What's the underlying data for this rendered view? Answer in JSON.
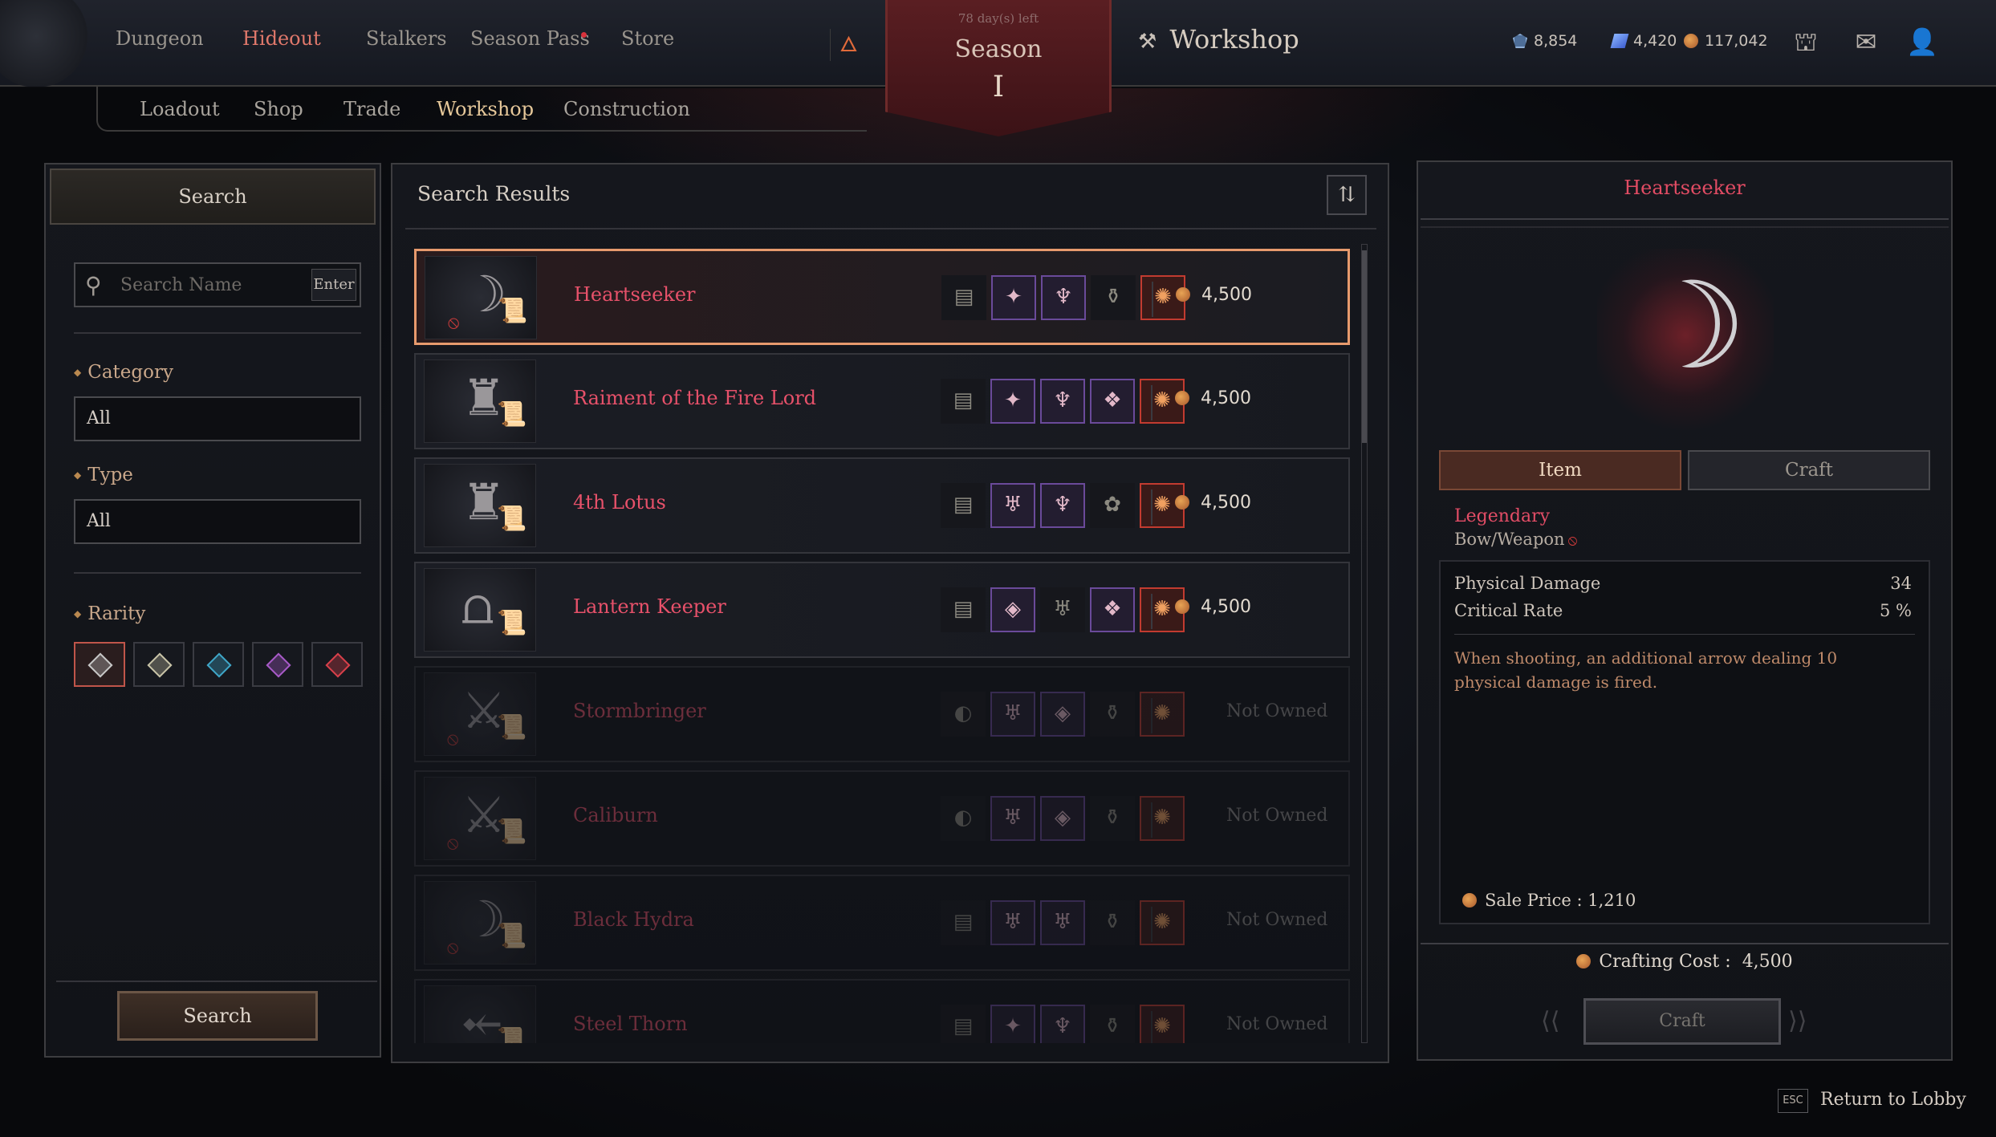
{
  "colors": {
    "accent_legendary": "#e24c64",
    "active_nav": "#e0786b",
    "active_subnav": "#e6c89a",
    "selected_border": "#e79a6d",
    "epic": "#6a4a9a",
    "legendary_frame": "#c23b30"
  },
  "top_nav": {
    "items": [
      {
        "label": "Dungeon",
        "active": false
      },
      {
        "label": "Hideout",
        "active": true
      },
      {
        "label": "Stalkers",
        "active": false
      },
      {
        "label": "Season Pass",
        "active": false,
        "notification": true
      },
      {
        "label": "Store",
        "active": false
      }
    ],
    "flame_icon": "flame-icon"
  },
  "season_banner": {
    "days_left": "78 day(s) left",
    "label": "Season",
    "numeral": "I"
  },
  "page_title": "Workshop",
  "currencies": [
    {
      "icon": "gem-shield-icon",
      "value": "8,854"
    },
    {
      "icon": "blue-crystal-icon",
      "value": "4,420"
    },
    {
      "icon": "gold-coin-icon",
      "value": "117,042"
    }
  ],
  "top_icons": [
    "treasure-chest-icon",
    "mail-icon",
    "friends-icon"
  ],
  "sub_nav": {
    "items": [
      {
        "label": "Loadout",
        "active": false
      },
      {
        "label": "Shop",
        "active": false
      },
      {
        "label": "Trade",
        "active": false
      },
      {
        "label": "Workshop",
        "active": true
      },
      {
        "label": "Construction",
        "active": false
      }
    ]
  },
  "filters": {
    "header": "Search",
    "search_placeholder": "Search Name",
    "search_value": "",
    "enter_label": "Enter",
    "category_label": "Category",
    "category_value": "All",
    "type_label": "Type",
    "type_value": "All",
    "rarity_label": "Rarity",
    "rarity_options": [
      {
        "name": "all",
        "color": "#c8c8c8",
        "selected": true
      },
      {
        "name": "uncommon",
        "color": "#c9c4a8",
        "selected": false
      },
      {
        "name": "rare",
        "color": "#3fa6c8",
        "selected": false
      },
      {
        "name": "epic",
        "color": "#a85ac8",
        "selected": false
      },
      {
        "name": "legendary",
        "color": "#d8404a",
        "selected": false
      }
    ],
    "search_button": "Search"
  },
  "results": {
    "title": "Search Results",
    "sort_icon": "sort-icon",
    "items": [
      {
        "name": "Heartseeker",
        "art": "bow",
        "banned": true,
        "price": "4,500",
        "owned": true,
        "selected": true,
        "materials": [
          {
            "glyph": "▤",
            "tone": "plain"
          },
          {
            "glyph": "✦",
            "tone": "purple"
          },
          {
            "glyph": "♆",
            "tone": "purple"
          },
          {
            "glyph": "⚱",
            "tone": "plain"
          },
          {
            "glyph": "✺",
            "tone": "red"
          }
        ]
      },
      {
        "name": "Raiment of the Fire Lord",
        "art": "robe",
        "banned": false,
        "price": "4,500",
        "owned": true,
        "selected": false,
        "materials": [
          {
            "glyph": "▤",
            "tone": "plain"
          },
          {
            "glyph": "✦",
            "tone": "purple"
          },
          {
            "glyph": "♆",
            "tone": "purple"
          },
          {
            "glyph": "❖",
            "tone": "purple"
          },
          {
            "glyph": "✺",
            "tone": "red"
          }
        ]
      },
      {
        "name": "4th Lotus",
        "art": "tunic",
        "banned": false,
        "price": "4,500",
        "owned": true,
        "selected": false,
        "materials": [
          {
            "glyph": "▤",
            "tone": "plain"
          },
          {
            "glyph": "♅",
            "tone": "purple"
          },
          {
            "glyph": "♆",
            "tone": "purple"
          },
          {
            "glyph": "✿",
            "tone": "plain"
          },
          {
            "glyph": "✺",
            "tone": "red"
          }
        ]
      },
      {
        "name": "Lantern Keeper",
        "art": "pants",
        "banned": false,
        "price": "4,500",
        "owned": true,
        "selected": false,
        "materials": [
          {
            "glyph": "▤",
            "tone": "plain"
          },
          {
            "glyph": "◈",
            "tone": "purple"
          },
          {
            "glyph": "♅",
            "tone": "plain"
          },
          {
            "glyph": "❖",
            "tone": "purple"
          },
          {
            "glyph": "✺",
            "tone": "red"
          }
        ]
      },
      {
        "name": "Stormbringer",
        "art": "sword",
        "banned": true,
        "owned": false,
        "status": "Not Owned",
        "selected": false,
        "materials": [
          {
            "glyph": "◐",
            "tone": "plain"
          },
          {
            "glyph": "♅",
            "tone": "purple"
          },
          {
            "glyph": "◈",
            "tone": "purple"
          },
          {
            "glyph": "⚱",
            "tone": "plain"
          },
          {
            "glyph": "✺",
            "tone": "red"
          }
        ]
      },
      {
        "name": "Caliburn",
        "art": "sword",
        "banned": true,
        "owned": false,
        "status": "Not Owned",
        "selected": false,
        "materials": [
          {
            "glyph": "◐",
            "tone": "plain"
          },
          {
            "glyph": "♅",
            "tone": "purple"
          },
          {
            "glyph": "◈",
            "tone": "purple"
          },
          {
            "glyph": "⚱",
            "tone": "plain"
          },
          {
            "glyph": "✺",
            "tone": "red"
          }
        ]
      },
      {
        "name": "Black Hydra",
        "art": "bow",
        "banned": true,
        "owned": false,
        "status": "Not Owned",
        "selected": false,
        "materials": [
          {
            "glyph": "▤",
            "tone": "plain"
          },
          {
            "glyph": "♅",
            "tone": "purple"
          },
          {
            "glyph": "♅",
            "tone": "purple"
          },
          {
            "glyph": "⚱",
            "tone": "plain"
          },
          {
            "glyph": "✺",
            "tone": "red"
          }
        ]
      },
      {
        "name": "Steel Thorn",
        "art": "crossbow",
        "banned": false,
        "owned": false,
        "status": "Not Owned",
        "selected": false,
        "materials": [
          {
            "glyph": "▤",
            "tone": "plain"
          },
          {
            "glyph": "✦",
            "tone": "purple"
          },
          {
            "glyph": "♆",
            "tone": "purple"
          },
          {
            "glyph": "⚱",
            "tone": "plain"
          },
          {
            "glyph": "✺",
            "tone": "red"
          }
        ]
      }
    ]
  },
  "detail": {
    "title": "Heartseeker",
    "tabs": [
      {
        "label": "Item",
        "active": true
      },
      {
        "label": "Craft",
        "active": false
      }
    ],
    "rarity": "Legendary",
    "type": "Bow/Weapon",
    "stats": [
      {
        "label": "Physical Damage",
        "value": "34"
      },
      {
        "label": "Critical Rate",
        "value": "5 %"
      }
    ],
    "description": "When shooting, an additional arrow dealing 10 physical damage is fired.",
    "sale_price_label": "Sale Price : 1,210",
    "crafting_cost_label": "Crafting Cost :",
    "crafting_cost_value": "4,500",
    "craft_button": "Craft"
  },
  "footer": {
    "esc_key": "ESC",
    "return_label": "Return to Lobby"
  }
}
